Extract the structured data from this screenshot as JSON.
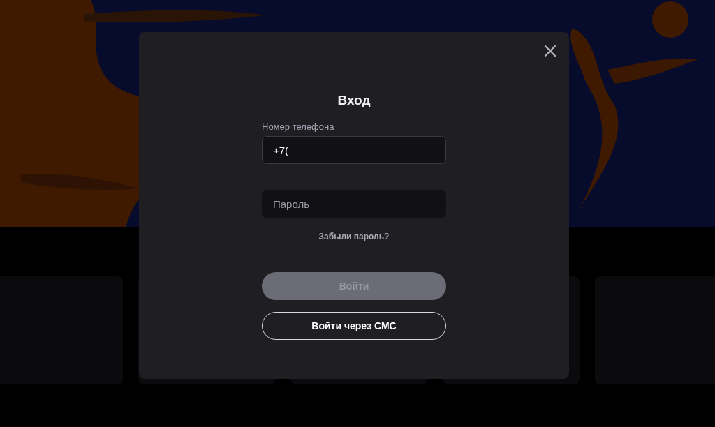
{
  "dialog": {
    "title": "Вход",
    "phone_field": {
      "label": "Номер телефона",
      "value": "+7("
    },
    "password_field": {
      "placeholder": "Пароль"
    },
    "forgot_link": "Забыли пароль?",
    "buttons": [
      {
        "label": "Войти",
        "kind": "primary",
        "disabled": true
      },
      {
        "label": "Войти через СМС",
        "kind": "outline",
        "disabled": false
      }
    ]
  }
}
